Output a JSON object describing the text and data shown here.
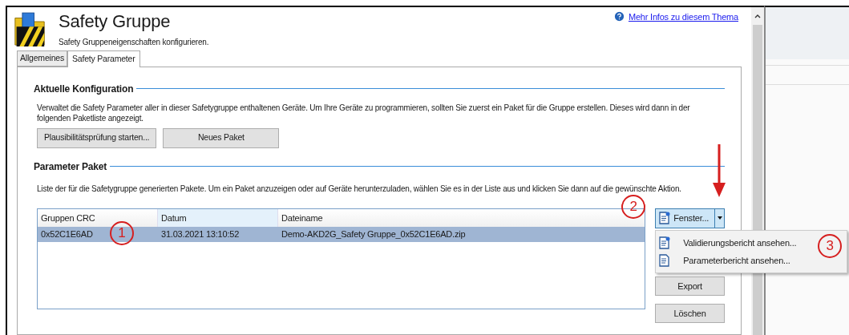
{
  "header": {
    "title": "Safety Gruppe",
    "subtitle": "Safety Gruppeneigenschaften konfigurieren.",
    "help_link": "Mehr Infos zu diesem Thema"
  },
  "tabs": [
    {
      "label": "Allgemeines",
      "selected": false
    },
    {
      "label": "Safety Parameter",
      "selected": true
    }
  ],
  "current_config": {
    "heading": "Aktuelle Konfiguration",
    "description": "Verwaltet die Safety Parameter aller in dieser Safetygruppe enthaltenen Geräte. Um Ihre Geräte zu programmieren, sollten Sie zuerst ein Paket für die Gruppe erstellen. Dieses wird dann in der folgenden Paketliste angezeigt.",
    "buttons": [
      "Plausibilitätsprüfung starten...",
      "Neues Paket"
    ]
  },
  "parameter_package": {
    "heading": "Parameter Paket",
    "description": "Liste der für die Safetygruppe generierten Pakete. Um ein Paket anzuzeigen oder auf Geräte herunterzuladen, wählen Sie es in der Liste aus und klicken Sie dann auf die gewünschte Aktion.",
    "table": {
      "columns": [
        "Gruppen CRC",
        "Datum",
        "Dateiname"
      ],
      "rows": [
        {
          "cells": [
            "0x52C1E6AD",
            "31.03.2021 13:10:52",
            "Demo-AKD2G_Safety Gruppe_0x52C1E6AD.zip"
          ],
          "selected": true
        }
      ]
    },
    "split_button": {
      "label": "Fenster...",
      "expanded": true
    },
    "menu": [
      "Validierungsbericht ansehen...",
      "Parameterbericht ansehen..."
    ],
    "buttons": [
      "Export",
      "Löschen"
    ]
  },
  "callouts": [
    "1",
    "2",
    "3"
  ]
}
